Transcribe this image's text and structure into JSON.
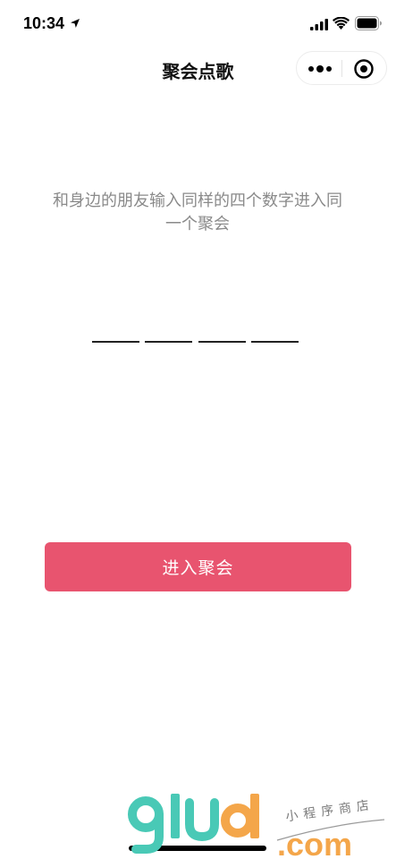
{
  "status_bar": {
    "time": "10:34"
  },
  "nav": {
    "title": "聚会点歌"
  },
  "instruction": {
    "line1": "和身边的朋友输入同样的四个数字进入同",
    "line2": "一个聚会"
  },
  "code": {
    "digits": [
      "",
      "",
      "",
      ""
    ]
  },
  "join_button": {
    "label": "进入聚会"
  },
  "colors": {
    "accent": "#e8546f",
    "instruction_text": "#8a8a8a",
    "title_text": "#111111"
  },
  "icons": {
    "location": "location-arrow-icon",
    "signal": "cellular-signal-icon",
    "wifi": "wifi-icon",
    "battery": "battery-icon",
    "more": "more-dots-icon",
    "close": "close-miniprogram-icon"
  },
  "watermark": {
    "logo": "9lud",
    "subtitle": "小程序商店",
    "domain": ".com"
  }
}
